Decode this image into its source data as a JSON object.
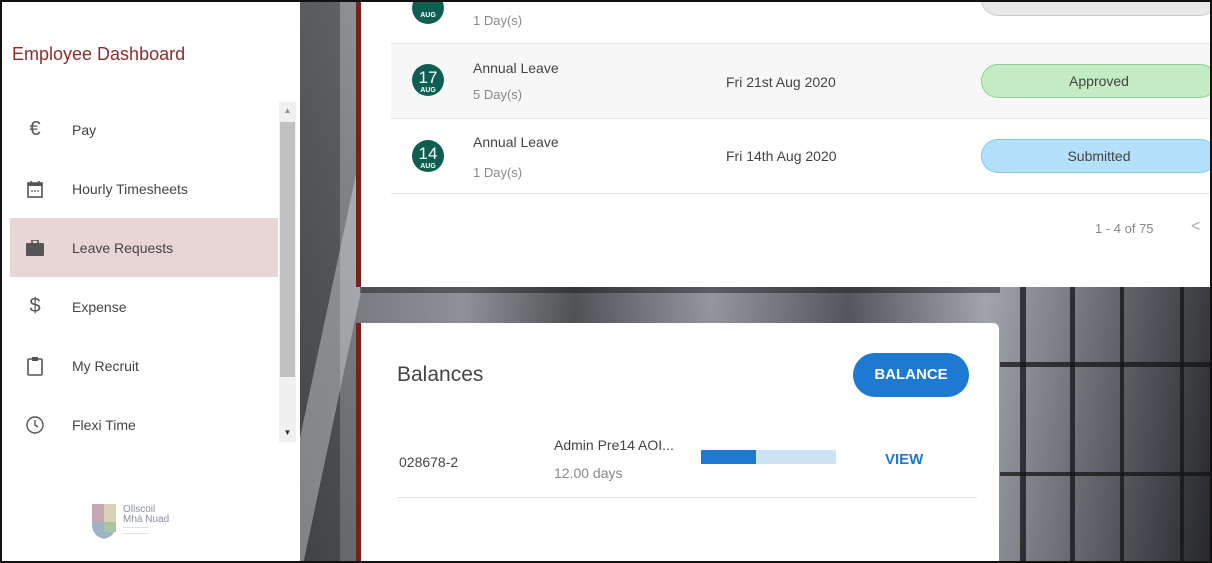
{
  "sidebar": {
    "title": "Employee Dashboard",
    "items": [
      {
        "label": "Pay",
        "icon": "euro-icon"
      },
      {
        "label": "Hourly Timesheets",
        "icon": "calendar-icon"
      },
      {
        "label": "Leave Requests",
        "icon": "briefcase-icon",
        "active": true
      },
      {
        "label": "Expense",
        "icon": "dollar-icon"
      },
      {
        "label": "My Recruit",
        "icon": "clipboard-icon"
      },
      {
        "label": "Flexi Time",
        "icon": "clock-icon"
      }
    ],
    "logo": {
      "line1": "Ollscoil",
      "line2": "Mhá Nuad"
    }
  },
  "leave_requests": {
    "rows": [
      {
        "day": "",
        "month": "AUG",
        "type": "",
        "days": "1 Day(s)",
        "date": "",
        "status": ""
      },
      {
        "day": "17",
        "month": "AUG",
        "type": "Annual Leave",
        "days": "5 Day(s)",
        "date": "Fri 21st Aug 2020",
        "status": "Approved"
      },
      {
        "day": "14",
        "month": "AUG",
        "type": "Annual Leave",
        "days": "1 Day(s)",
        "date": "Fri 14th Aug 2020",
        "status": "Submitted"
      }
    ],
    "pager": "1 - 4 of 75",
    "pager_prev": "<"
  },
  "balances": {
    "title": "Balances",
    "button_label": "BALANCE",
    "row": {
      "id": "028678-2",
      "name": "Admin Pre14 AOI...",
      "amount": "12.00 days",
      "usage_fraction": 0.41,
      "action": "VIEW"
    }
  },
  "colors": {
    "brand_red": "#8e2b2b",
    "approved": "#c3ecc4",
    "submitted": "#b3e0fb",
    "primary_blue": "#1d79d1",
    "badge_green": "#0e5e51"
  }
}
